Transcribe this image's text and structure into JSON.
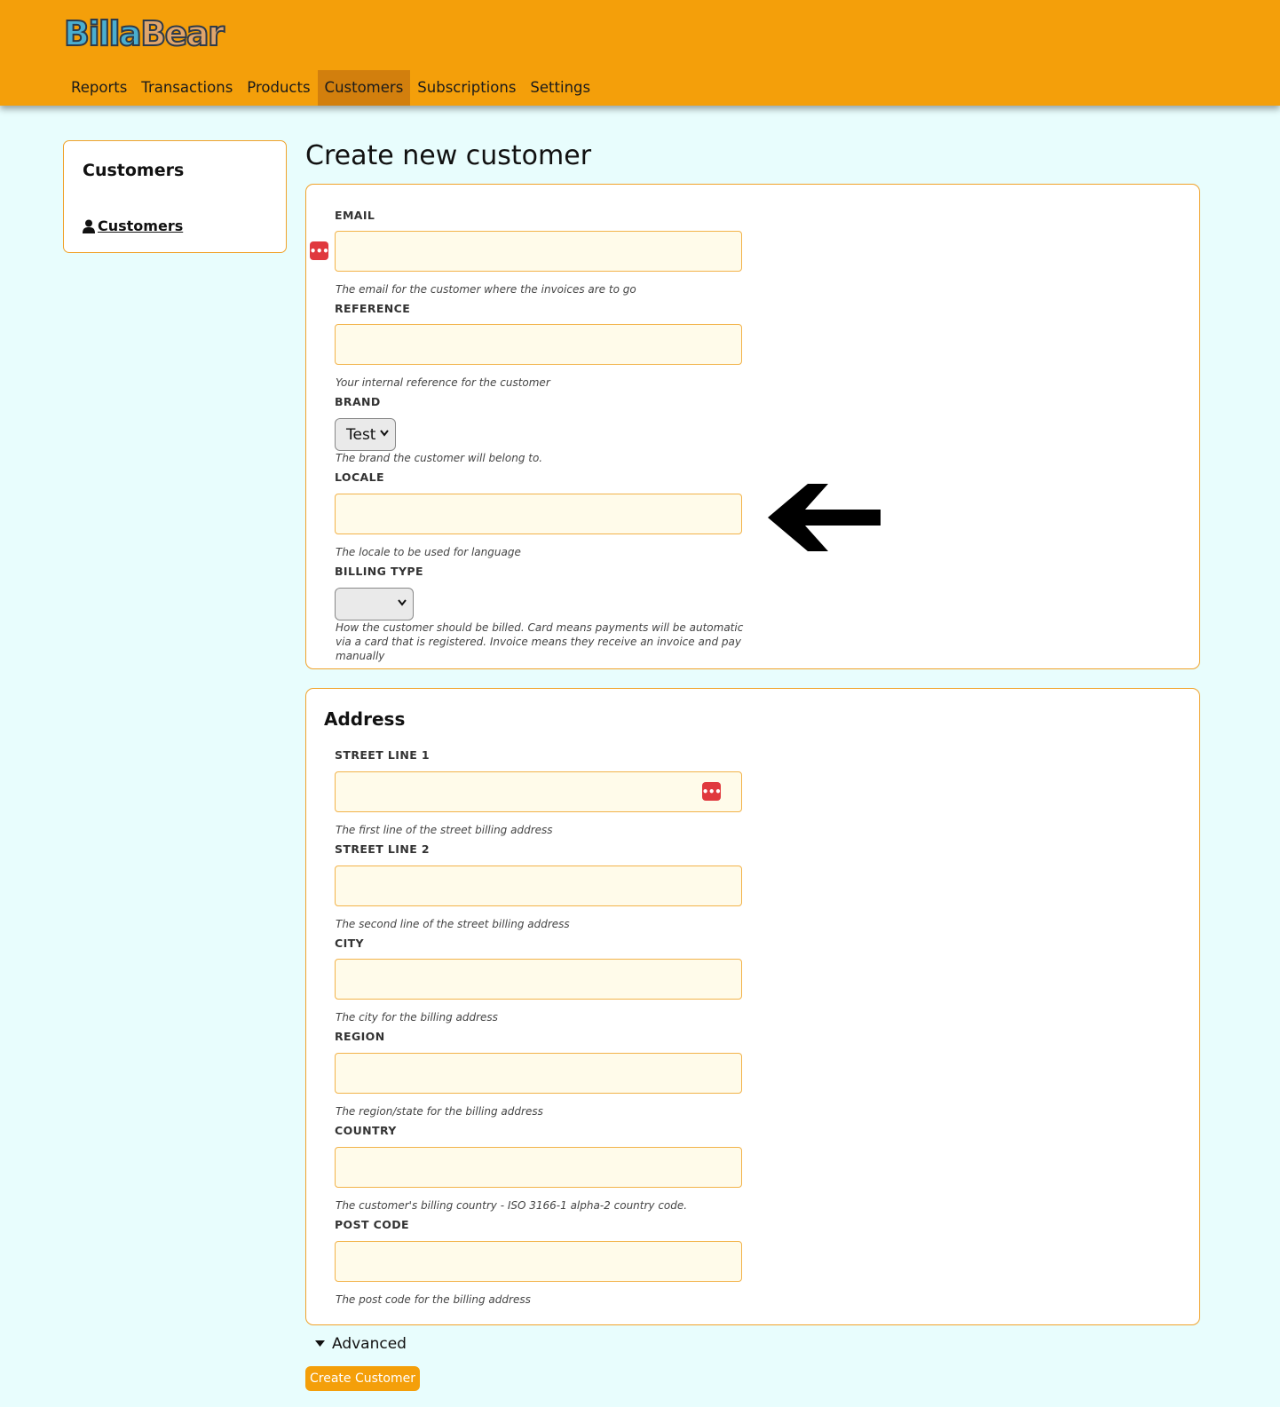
{
  "app": {
    "logo_part1": "Billa",
    "logo_part2": "Bear"
  },
  "nav": {
    "items": [
      "Reports",
      "Transactions",
      "Products",
      "Customers",
      "Subscriptions",
      "Settings"
    ],
    "active": "Customers"
  },
  "sidebar": {
    "title": "Customers",
    "link": "Customers"
  },
  "page": {
    "title": "Create new customer"
  },
  "customer_form": {
    "email": {
      "label": "EMAIL",
      "value": "",
      "help": "The email for the customer where the invoices are to go"
    },
    "reference": {
      "label": "REFERENCE",
      "value": "",
      "help": "Your internal reference for the customer"
    },
    "brand": {
      "label": "BRAND",
      "selected": "Test",
      "help": "The brand the customer will belong to."
    },
    "locale": {
      "label": "LOCALE",
      "value": "",
      "help": "The locale to be used for language"
    },
    "billing_type": {
      "label": "BILLING TYPE",
      "selected": "",
      "help": "How the customer should be billed. Card means payments will be automatic via a card that is registered. Invoice means they receive an invoice and pay manually"
    }
  },
  "address_form": {
    "title": "Address",
    "street_line_1": {
      "label": "STREET LINE 1",
      "value": "",
      "help": "The first line of the street billing address"
    },
    "street_line_2": {
      "label": "STREET LINE 2",
      "value": "",
      "help": "The second line of the street billing address"
    },
    "city": {
      "label": "CITY",
      "value": "",
      "help": "The city for the billing address"
    },
    "region": {
      "label": "REGION",
      "value": "",
      "help": "The region/state for the billing address"
    },
    "country": {
      "label": "COUNTRY",
      "value": "",
      "help": "The customer's billing country - ISO 3166-1 alpha-2 country code."
    },
    "post_code": {
      "label": "POST CODE",
      "value": "",
      "help": "The post code for the billing address"
    }
  },
  "advanced": {
    "label": "Advanced"
  },
  "submit": {
    "label": "Create Customer"
  },
  "colors": {
    "header": "#f49f0a",
    "nav_active": "#d27f0d",
    "background": "#e8fdfd",
    "input_bg": "#fffbea",
    "input_border": "#f2b34a",
    "password_badge": "#e0393e"
  },
  "icons": {
    "sidebar_link": "user-icon",
    "password_manager": "dots-badge-icon",
    "advanced_toggle": "caret-down-icon",
    "annotation": "left-arrow-icon"
  }
}
